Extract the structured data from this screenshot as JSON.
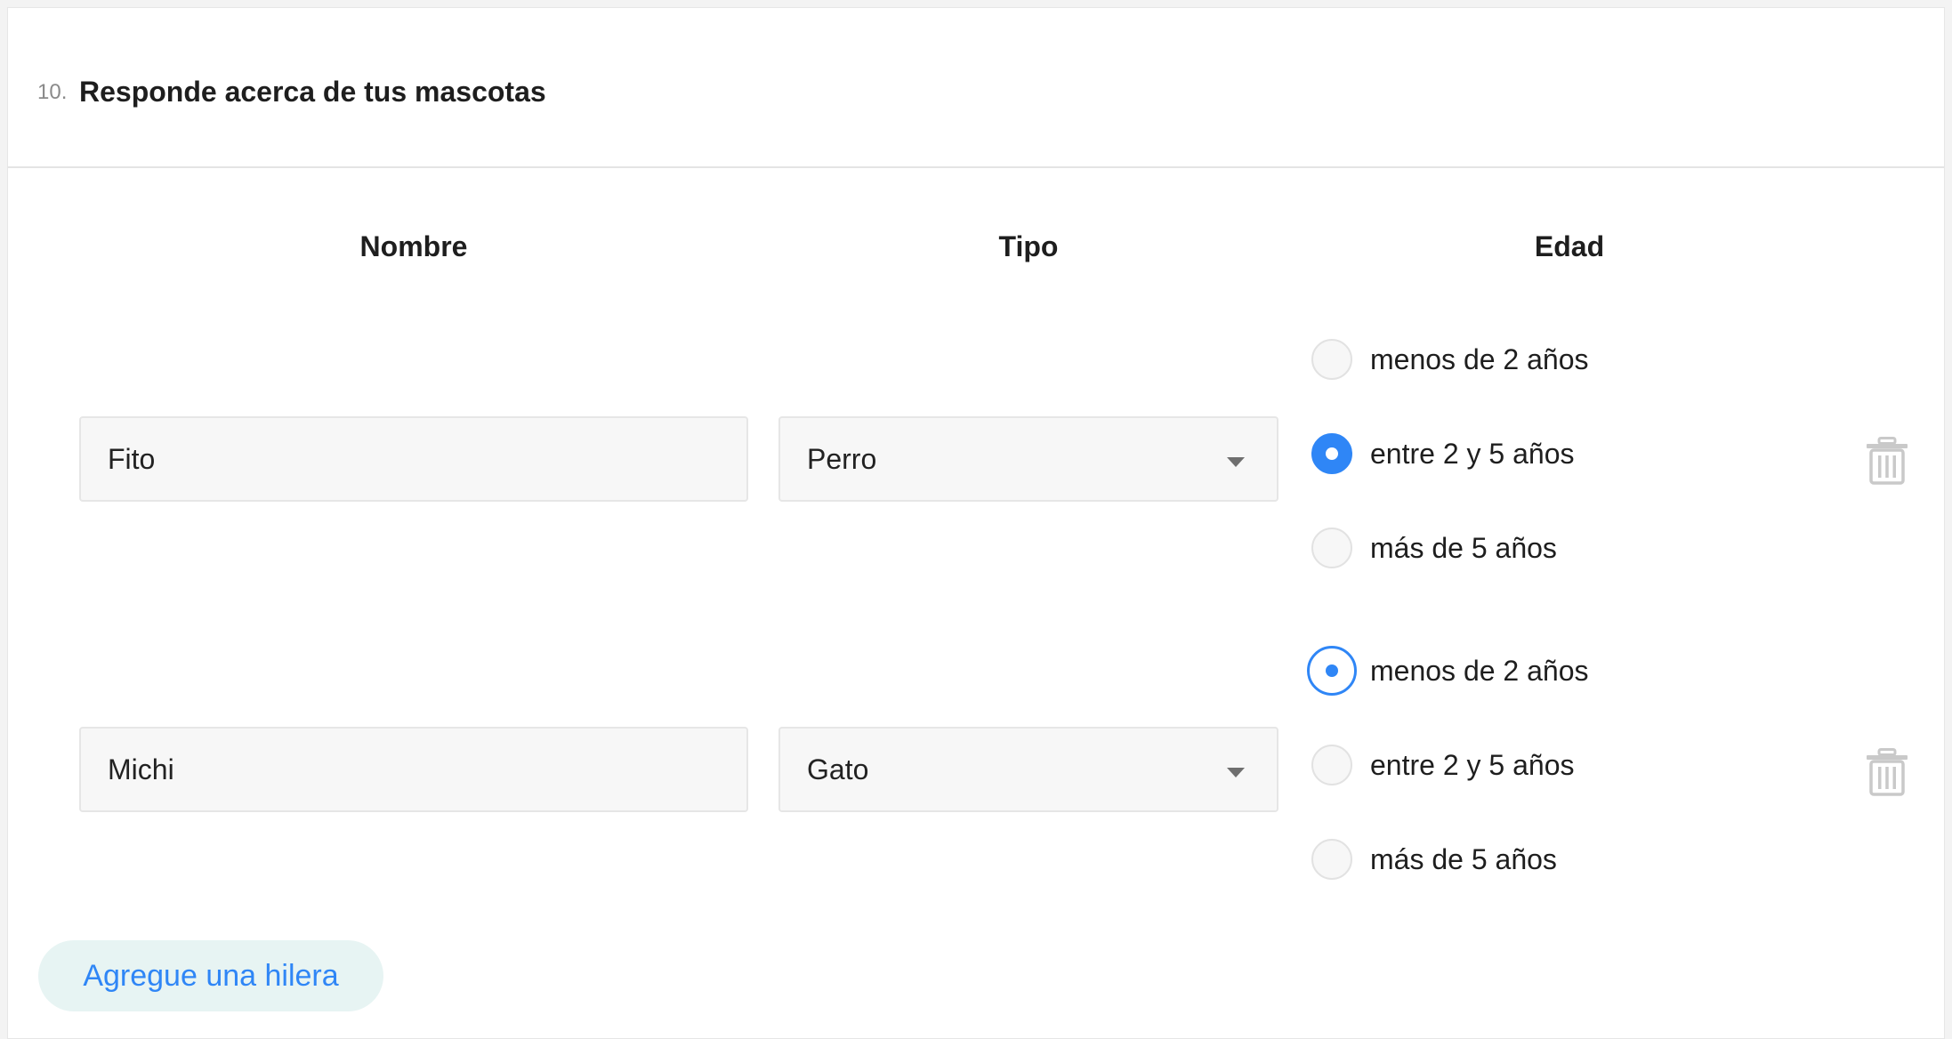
{
  "question": {
    "number": "10.",
    "title": "Responde acerca de tus mascotas"
  },
  "columns": [
    "Nombre",
    "Tipo",
    "Edad"
  ],
  "rows": [
    {
      "nombre": "Fito",
      "tipo": "Perro",
      "edad_options": [
        "menos de 2 años",
        "entre 2 y 5 años",
        "más de 5 años"
      ],
      "edad_selected": "entre 2 y 5 años"
    },
    {
      "nombre": "Michi",
      "tipo": "Gato",
      "edad_options": [
        "menos de 2 años",
        "entre 2 y 5 años",
        "más de 5 años"
      ],
      "edad_selected": "menos de 2 años"
    }
  ],
  "add_row_label": "Agregue una hilera",
  "colors": {
    "accent": "#2f86f6",
    "add_row_bg": "#e7f4f3",
    "input_bg": "#f7f7f7"
  },
  "icons": {
    "delete": "trash-icon",
    "dropdown": "caret-down-icon"
  }
}
